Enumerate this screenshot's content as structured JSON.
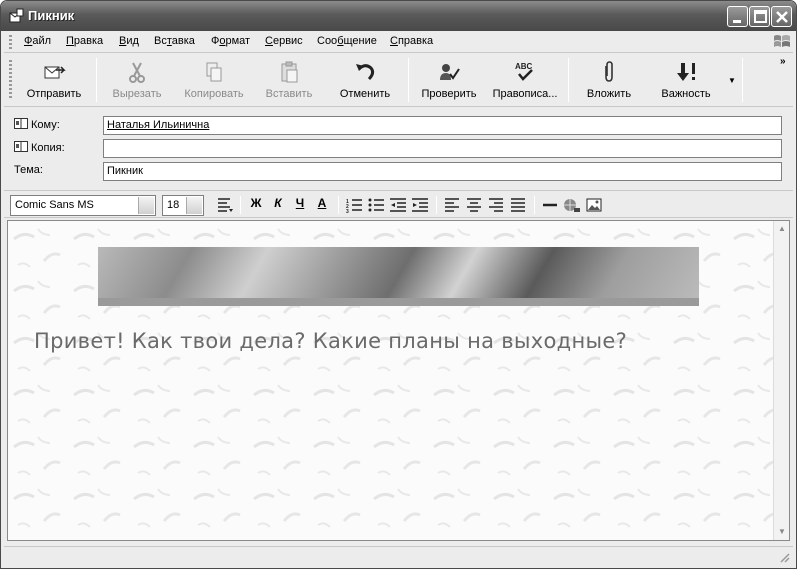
{
  "window": {
    "title": "Пикник"
  },
  "menu": {
    "items": [
      {
        "label": "Файл",
        "accel": "Ф",
        "rest": "айл"
      },
      {
        "label": "Правка",
        "accel": "П",
        "rest": "равка"
      },
      {
        "label": "Вид",
        "accel": "В",
        "rest": "ид"
      },
      {
        "label": "Вставка",
        "accel": "т",
        "pre": "Вс",
        "rest": "авка"
      },
      {
        "label": "Формат",
        "accel": "о",
        "pre": "Ф",
        "rest": "рмат"
      },
      {
        "label": "Сервис",
        "accel": "С",
        "rest": "ервис"
      },
      {
        "label": "Сообщение",
        "accel": "б",
        "pre": "Соо",
        "rest": "щение"
      },
      {
        "label": "Справка",
        "accel": "С",
        "rest": "правка"
      }
    ]
  },
  "toolbar": {
    "send": "Отправить",
    "cut": "Вырезать",
    "copy": "Копировать",
    "paste": "Вставить",
    "undo": "Отменить",
    "check": "Проверить",
    "spelling": "Правописа...",
    "attach": "Вложить",
    "priority": "Важность",
    "more": "»"
  },
  "headers": {
    "to_label": "Кому:",
    "to_value": "Наталья Ильинична",
    "cc_label": "Копия:",
    "cc_value": "",
    "subject_label": "Тема:",
    "subject_value": "Пикник"
  },
  "format": {
    "font": "Comic Sans MS",
    "size": "18",
    "bold": "Ж",
    "italic": "К",
    "underline": "Ч",
    "color": "А"
  },
  "body": {
    "message": "Привет! Как твои дела? Какие планы на выходные?"
  },
  "colors": {
    "titlebar": "#5a5a5a",
    "chrome": "#ececec",
    "message_text": "#6a6a6a"
  }
}
